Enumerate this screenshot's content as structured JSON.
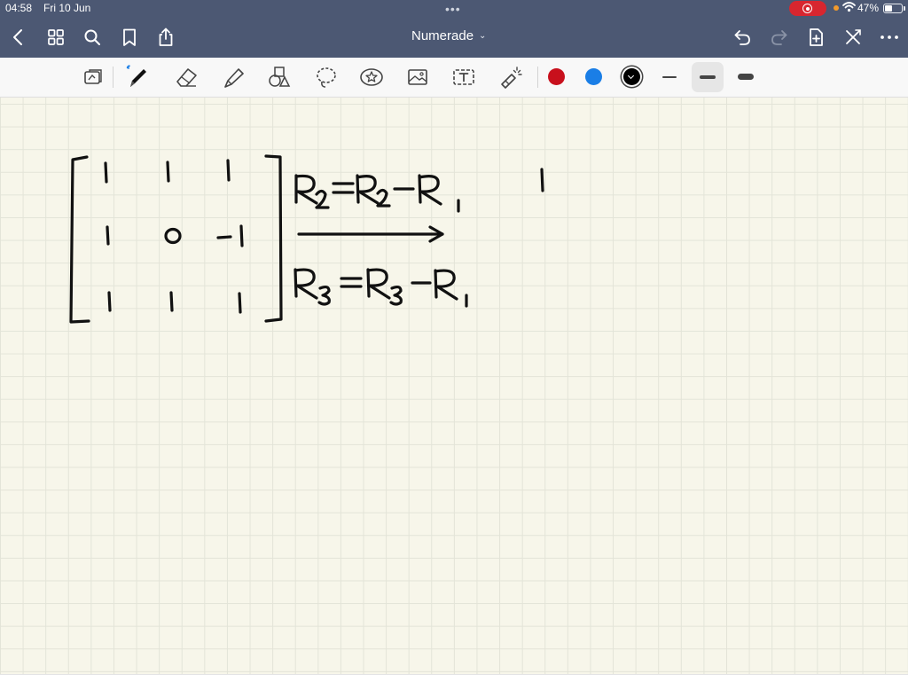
{
  "status_bar": {
    "time": "04:58",
    "date": "Fri 10 Jun",
    "battery_percent": "47%",
    "battery_level": 0.47,
    "recording_active": true
  },
  "nav_bar": {
    "document_title": "Numerade",
    "icons": [
      "back-icon",
      "thumbnails-icon",
      "search-icon",
      "bookmark-icon",
      "share-icon",
      "undo-icon",
      "redo-icon",
      "add-page-icon",
      "close-icon",
      "more-icon"
    ]
  },
  "toolbar": {
    "tools": [
      "readonly-mode-icon",
      "pen-icon",
      "eraser-icon",
      "highlighter-icon",
      "shapes-icon",
      "lasso-icon",
      "sticker-icon",
      "image-icon",
      "text-icon",
      "laser-pointer-icon"
    ],
    "selected_tool": "pen",
    "colors": [
      "#c8101c",
      "#1a7ee6",
      "#000000"
    ],
    "selected_color": "#000000",
    "stroke_widths": [
      "thin",
      "medium",
      "thick"
    ],
    "selected_width": "medium"
  }
}
